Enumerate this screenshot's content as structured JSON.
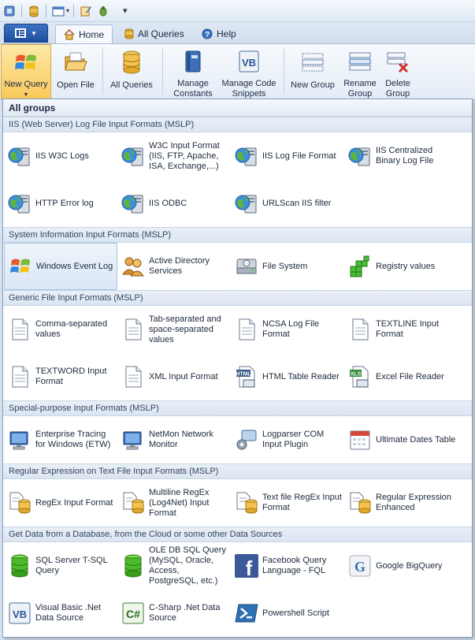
{
  "quick_access": {
    "icons": [
      "app-icon",
      "database-icon",
      "window-icon",
      "edit-icon",
      "bug-icon"
    ],
    "more": "▾"
  },
  "tabs": [
    {
      "label": "Home",
      "icon": "home-icon"
    },
    {
      "label": "All Queries",
      "icon": "database-icon"
    },
    {
      "label": "Help",
      "icon": "help-icon"
    }
  ],
  "ribbon": {
    "new_query": "New Query",
    "open_file": "Open File",
    "all_queries": "All Queries",
    "manage_constants": "Manage Constants",
    "manage_code_snippets": "Manage Code Snippets",
    "new_group": "New Group",
    "rename_group": "Rename Group",
    "delete_group": "Delete Group"
  },
  "panel": {
    "title": "All groups",
    "groups": [
      {
        "header": "IIS (Web Server) Log File Input Formats (MSLP)",
        "items": [
          {
            "label": "IIS W3C Logs",
            "icon": "iis-server-icon"
          },
          {
            "label": "W3C Input Format (IIS, FTP, Apache, ISA, Exchange,...)",
            "icon": "iis-server-icon"
          },
          {
            "label": "IIS Log File Format",
            "icon": "iis-server-icon"
          },
          {
            "label": "IIS Centralized Binary Log File",
            "icon": "iis-server-icon"
          },
          {
            "label": "HTTP Error log",
            "icon": "iis-server-icon"
          },
          {
            "label": "IIS ODBC",
            "icon": "iis-server-icon"
          },
          {
            "label": "URLScan IIS filter",
            "icon": "iis-server-icon"
          }
        ]
      },
      {
        "header": "System Information Input Formats (MSLP)",
        "items": [
          {
            "label": "Windows Event Log",
            "icon": "windows-flag-icon"
          },
          {
            "label": "Active Directory Services",
            "icon": "users-icon"
          },
          {
            "label": "File System",
            "icon": "disk-drive-icon"
          },
          {
            "label": "Registry values",
            "icon": "registry-icon"
          }
        ]
      },
      {
        "header": "Generic File Input Formats (MSLP)",
        "items": [
          {
            "label": "Comma-separated values",
            "icon": "document-icon"
          },
          {
            "label": "Tab-separated and space-separated values",
            "icon": "document-icon"
          },
          {
            "label": "NCSA Log File Format",
            "icon": "document-icon"
          },
          {
            "label": "TEXTLINE Input Format",
            "icon": "document-icon"
          },
          {
            "label": "TEXTWORD Input Format",
            "icon": "document-icon"
          },
          {
            "label": "XML Input Format",
            "icon": "document-icon"
          },
          {
            "label": "HTML Table Reader",
            "icon": "html-file-icon"
          },
          {
            "label": "Excel File Reader",
            "icon": "xls-file-icon"
          }
        ]
      },
      {
        "header": "Special-purpose Input Formats (MSLP)",
        "items": [
          {
            "label": "Enterprise Tracing for Windows (ETW)",
            "icon": "computer-icon"
          },
          {
            "label": "NetMon Network Monitor",
            "icon": "computer-icon"
          },
          {
            "label": "Logparser COM Input Plugin",
            "icon": "plugin-gear-icon"
          },
          {
            "label": "Ultimate Dates Table",
            "icon": "calendar-icon"
          }
        ]
      },
      {
        "header": "Regular Expression on Text File Input Formats (MSLP)",
        "items": [
          {
            "label": "RegEx Input Format",
            "icon": "regex-db-icon"
          },
          {
            "label": "Multiline RegEx (Log4Net) Input Format",
            "icon": "regex-db-icon"
          },
          {
            "label": "Text file RegEx Input Format",
            "icon": "regex-db-icon"
          },
          {
            "label": "Regular Expression Enhanced",
            "icon": "regex-db-icon"
          }
        ]
      },
      {
        "header": "Get Data from a Database, from the Cloud or some other Data Sources",
        "items": [
          {
            "label": "SQL Server T-SQL Query",
            "icon": "green-database-icon"
          },
          {
            "label": "OLE DB SQL Query (MySQL, Oracle, Access, PostgreSQL, etc.)",
            "icon": "green-database-icon"
          },
          {
            "label": "Facebook Query Language - FQL",
            "icon": "facebook-icon"
          },
          {
            "label": "Google BigQuery",
            "icon": "google-icon"
          },
          {
            "label": "Visual Basic .Net Data Source",
            "icon": "vb-icon"
          },
          {
            "label": "C-Sharp .Net Data Source",
            "icon": "csharp-icon"
          },
          {
            "label": "Powershell Script",
            "icon": "powershell-icon"
          }
        ]
      }
    ]
  }
}
